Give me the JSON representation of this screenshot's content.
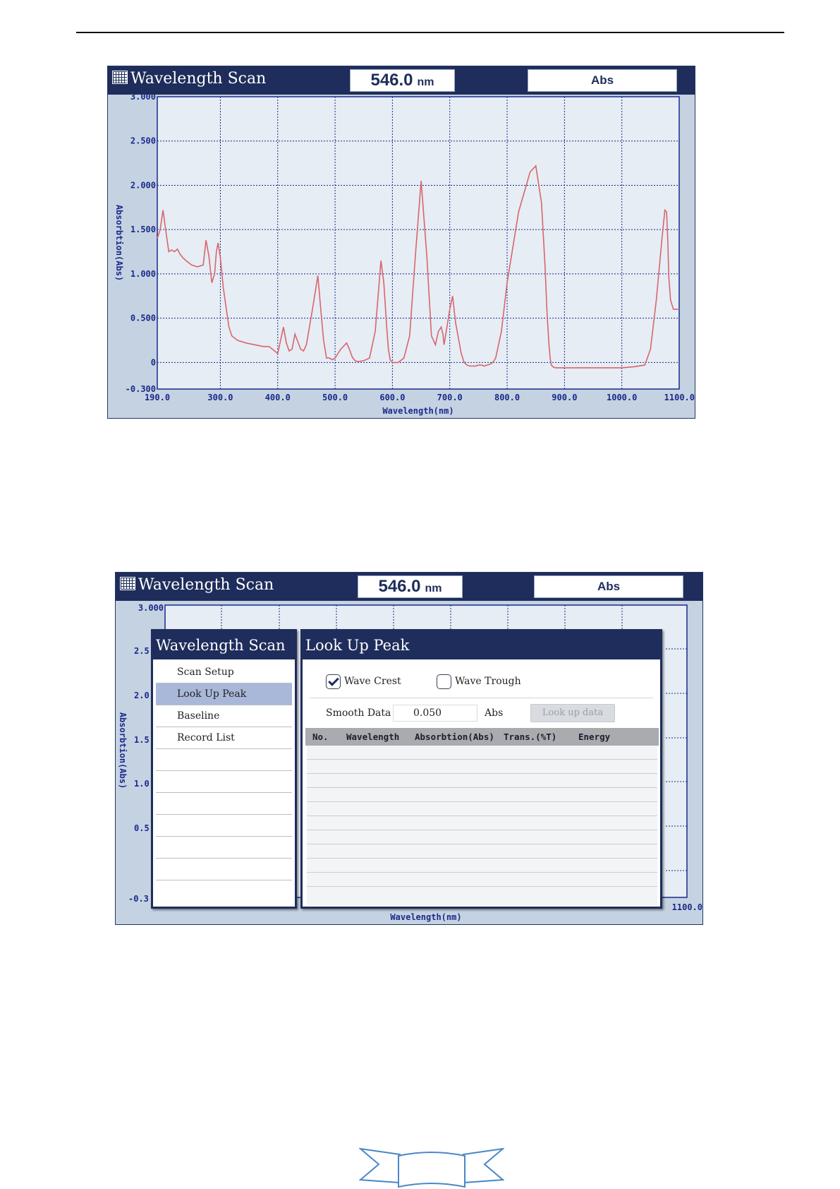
{
  "top_screen": {
    "title": "Wavelength Scan",
    "wavelength_value": "546.0",
    "wavelength_unit": "nm",
    "mode": "Abs"
  },
  "bottom_screen": {
    "title": "Wavelength Scan",
    "wavelength_value": "546.0",
    "wavelength_unit": "nm",
    "mode": "Abs",
    "y_tick_labels_visible": [
      "3.000",
      "2.5",
      "2.0",
      "1.5",
      "1.0",
      "0.5",
      "-0.3"
    ],
    "x_tick_label_visible": "1100.0",
    "ylabel": "Absorbtion(Abs)",
    "xlabel": "Wavelength(nm)"
  },
  "menu": {
    "title": "Wavelength Scan",
    "items": [
      {
        "label": "Scan Setup",
        "selected": false
      },
      {
        "label": "Look Up Peak",
        "selected": true
      },
      {
        "label": "Baseline",
        "selected": false
      },
      {
        "label": "Record List",
        "selected": false
      },
      {
        "label": "",
        "selected": false
      },
      {
        "label": "",
        "selected": false
      },
      {
        "label": "",
        "selected": false
      },
      {
        "label": "",
        "selected": false
      },
      {
        "label": "",
        "selected": false
      },
      {
        "label": "",
        "selected": false
      }
    ]
  },
  "lookup_panel": {
    "title": "Look Up Peak",
    "wave_crest_label": "Wave Crest",
    "wave_crest_checked": true,
    "wave_trough_label": "Wave Trough",
    "wave_trough_checked": false,
    "smooth_label": "Smooth Data",
    "smooth_value": "0.050",
    "smooth_unit": "Abs",
    "lookup_button": "Look up data",
    "columns": [
      "No.",
      "Wavelength",
      "Absorbtion(Abs)",
      "Trans.(%T)",
      "Energy"
    ],
    "rows": []
  },
  "colors": {
    "title_bar": "#1e2d5b",
    "screen_bg": "#c5d2e2",
    "plot_bg": "#e6edf4",
    "grid": "#1a2a8a",
    "curve": "#d9656d",
    "selected_menu": "#a9b8d8"
  },
  "icons": [
    "grid-icon"
  ],
  "chart_data": {
    "type": "line",
    "title": "",
    "xlabel": "Wavelength(nm)",
    "ylabel": "Absorbtion(Abs)",
    "xlim": [
      190,
      1100
    ],
    "ylim": [
      -0.3,
      3.0
    ],
    "x_tick_values": [
      190,
      300,
      400,
      500,
      600,
      700,
      800,
      900,
      1000,
      1100
    ],
    "x_tick_labels": [
      "190.0",
      "300.0",
      "400.0",
      "500.0",
      "600.0",
      "700.0",
      "800.0",
      "900.0",
      "1000.0",
      "1100.0"
    ],
    "y_tick_values": [
      -0.3,
      0,
      0.5,
      1.0,
      1.5,
      2.0,
      2.5,
      3.0
    ],
    "y_tick_labels": [
      "-0.300",
      "0",
      "0.500",
      "1.000",
      "1.500",
      "2.000",
      "2.500",
      "3.000"
    ],
    "grid": true,
    "legend": "none",
    "series": [
      {
        "x": [
          190,
          195,
          200,
          205,
          210,
          215,
          220,
          225,
          230,
          235,
          240,
          250,
          260,
          270,
          275,
          280,
          285,
          290,
          293,
          296,
          300,
          305,
          310,
          315,
          320,
          330,
          345,
          360,
          375,
          385,
          400,
          405,
          410,
          415,
          420,
          425,
          430,
          440,
          445,
          450,
          460,
          470,
          475,
          480,
          485,
          490,
          495,
          500,
          510,
          520,
          525,
          530,
          535,
          540,
          550,
          560,
          570,
          575,
          580,
          585,
          590,
          593,
          596,
          600,
          605,
          610,
          620,
          630,
          640,
          650,
          660,
          668,
          675,
          680,
          685,
          688,
          690,
          692,
          695,
          700,
          705,
          710,
          720,
          725,
          730,
          735,
          740,
          745,
          750,
          755,
          760,
          765,
          770,
          775,
          780,
          790,
          800,
          820,
          840,
          850,
          860,
          866,
          870,
          873,
          875,
          877,
          880,
          884,
          890,
          895,
          900,
          905,
          910,
          920,
          940,
          960,
          980,
          1000,
          1020,
          1040,
          1050,
          1060,
          1070,
          1075,
          1078,
          1080,
          1082,
          1085,
          1090,
          1095,
          1100
        ],
        "y": [
          1.4,
          1.5,
          1.72,
          1.48,
          1.25,
          1.27,
          1.25,
          1.28,
          1.22,
          1.18,
          1.15,
          1.1,
          1.08,
          1.1,
          1.38,
          1.2,
          0.9,
          1.0,
          1.25,
          1.35,
          1.18,
          0.85,
          0.62,
          0.4,
          0.3,
          0.25,
          0.22,
          0.2,
          0.18,
          0.18,
          0.1,
          0.25,
          0.4,
          0.22,
          0.13,
          0.15,
          0.32,
          0.15,
          0.13,
          0.2,
          0.58,
          0.98,
          0.6,
          0.25,
          0.05,
          0.05,
          0.03,
          0.05,
          0.15,
          0.22,
          0.15,
          0.06,
          0.02,
          0.01,
          0.02,
          0.05,
          0.35,
          0.75,
          1.15,
          0.9,
          0.4,
          0.15,
          0.03,
          0.0,
          0.0,
          0.0,
          0.05,
          0.3,
          1.2,
          2.05,
          1.2,
          0.3,
          0.2,
          0.35,
          0.4,
          0.32,
          0.2,
          0.28,
          0.4,
          0.6,
          0.75,
          0.45,
          0.1,
          0.0,
          -0.03,
          -0.04,
          -0.04,
          -0.04,
          -0.03,
          -0.03,
          -0.04,
          -0.03,
          -0.02,
          0.0,
          0.05,
          0.35,
          0.9,
          1.7,
          2.15,
          2.22,
          1.8,
          1.1,
          0.5,
          0.2,
          0.05,
          -0.03,
          -0.05,
          -0.06,
          -0.06,
          -0.06,
          -0.06,
          -0.06,
          -0.06,
          -0.06,
          -0.06,
          -0.06,
          -0.06,
          -0.06,
          -0.05,
          -0.03,
          0.15,
          0.7,
          1.4,
          1.72,
          1.7,
          1.4,
          0.95,
          0.7,
          0.6,
          0.6,
          0.6
        ]
      }
    ]
  }
}
